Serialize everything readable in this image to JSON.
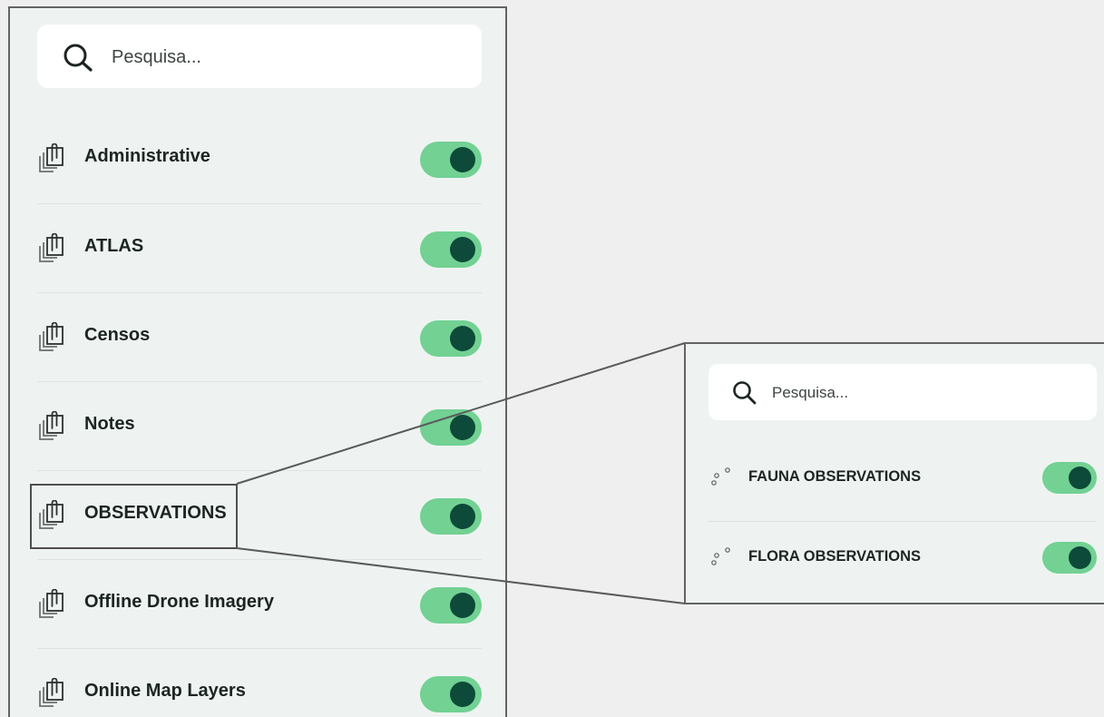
{
  "main_panel": {
    "search": {
      "placeholder": "Pesquisa..."
    },
    "layers": [
      {
        "label": "Administrative",
        "enabled": true
      },
      {
        "label": "ATLAS",
        "enabled": true
      },
      {
        "label": "Censos",
        "enabled": true
      },
      {
        "label": "Notes",
        "enabled": true
      },
      {
        "label": "OBSERVATIONS",
        "enabled": true
      },
      {
        "label": "Offline Drone Imagery",
        "enabled": true
      },
      {
        "label": "Online Map Layers",
        "enabled": true
      }
    ]
  },
  "zoom_panel": {
    "search": {
      "placeholder": "Pesquisa..."
    },
    "sublayers": [
      {
        "label": "FAUNA OBSERVATIONS",
        "enabled": true
      },
      {
        "label": "FLORA OBSERVATIONS",
        "enabled": true
      }
    ]
  },
  "icons": {
    "search": "search-icon",
    "layer_group": "layer-group-icon",
    "point_layer": "point-layer-icon"
  },
  "colors": {
    "page_background": "#efefef",
    "panel_background": "#eef3f1",
    "toggle_track_on": "#72d193",
    "toggle_knob": "#0d4a39",
    "text": "#1c2522"
  }
}
